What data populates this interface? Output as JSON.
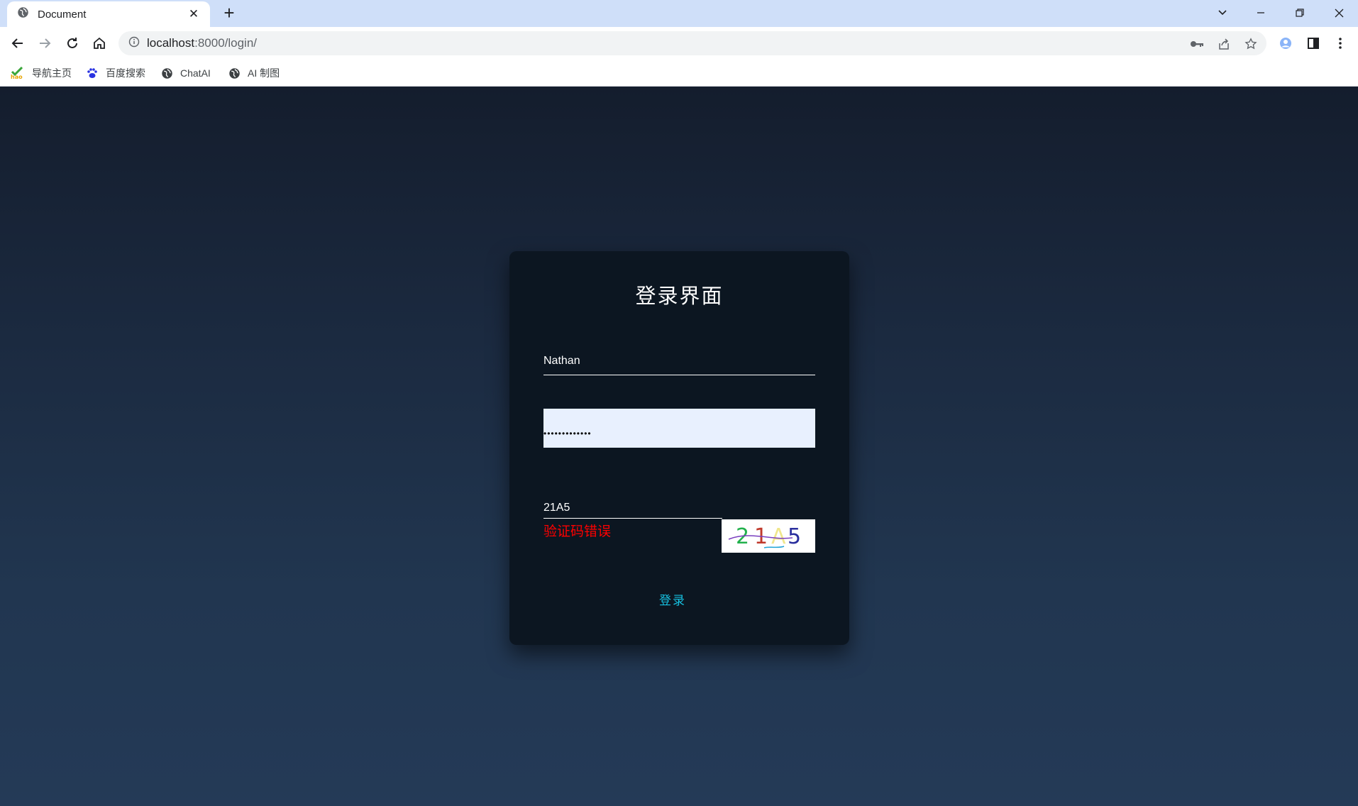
{
  "browser": {
    "tab_title": "Document",
    "url_host": "localhost",
    "url_path": ":8000/login/",
    "bookmarks": [
      {
        "label": "导航主页",
        "icon": "hao-icon"
      },
      {
        "label": "百度搜索",
        "icon": "baidu-paw-icon"
      },
      {
        "label": "ChatAI",
        "icon": "globe-icon"
      },
      {
        "label": "AI 制图",
        "icon": "globe-icon"
      }
    ]
  },
  "login": {
    "title": "登录界面",
    "username": "Nathan",
    "password_masked": "•••••••••••••",
    "captcha_input": "21A5",
    "captcha_image_text": "21A5",
    "error": "验证码错误",
    "submit": "登录"
  },
  "colors": {
    "card_bg": "#0c1621",
    "error": "#ff0000",
    "accent": "#16c0e0",
    "tabstrip": "#cfdff9"
  }
}
